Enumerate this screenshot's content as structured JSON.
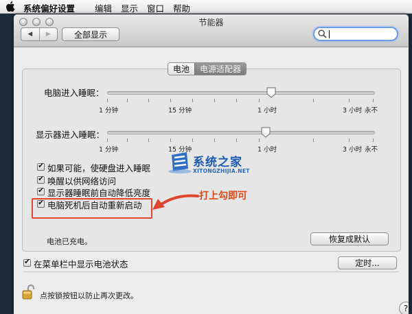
{
  "menubar": {
    "app_name": "系统偏好设置",
    "items": [
      "编辑",
      "显示",
      "窗口",
      "帮助"
    ]
  },
  "window": {
    "title": "节能器",
    "show_all_label": "全部显示",
    "search_placeholder": ""
  },
  "tabs": [
    {
      "label": "电池",
      "selected": true
    },
    {
      "label": "电源适配器",
      "selected": false
    }
  ],
  "sliders": [
    {
      "label": "电脑进入睡眠：",
      "position": 0.64,
      "tick_labels": [
        "1 分钟",
        "15 分钟",
        "1 小时",
        "3 小时",
        "永不"
      ]
    },
    {
      "label": "显示器进入睡眠：",
      "position": 0.61,
      "tick_labels": [
        "1 分钟",
        "15 分钟",
        "1 小时",
        "3 小时",
        "永不"
      ]
    }
  ],
  "checkboxes": [
    {
      "label": "如果可能，使硬盘进入睡眠",
      "checked": true
    },
    {
      "label": "唤醒以供网络访问",
      "checked": true
    },
    {
      "label": "显示器睡眠前自动降低亮度",
      "checked": true
    },
    {
      "label": "电脑死机后自动重新启动",
      "checked": true
    }
  ],
  "status": {
    "battery_text": "电池已充电。",
    "restore_defaults_label": "恢复成默认"
  },
  "footer": {
    "menubar_battery_label": "在菜单栏中显示电池状态",
    "menubar_battery_checked": true,
    "schedule_label": "定时...",
    "lock_text": "点按锁按钮以防止再次更改。",
    "help_label": "?"
  },
  "annotation": {
    "text": "打上勾即可"
  },
  "watermark": {
    "name": "系统之家",
    "url": "XITONGZHIJIA.NET"
  },
  "colors": {
    "annotation_red": "#e0452e",
    "focus_blue": "#6d9de6",
    "watermark_blue": "#1c5bb0"
  }
}
